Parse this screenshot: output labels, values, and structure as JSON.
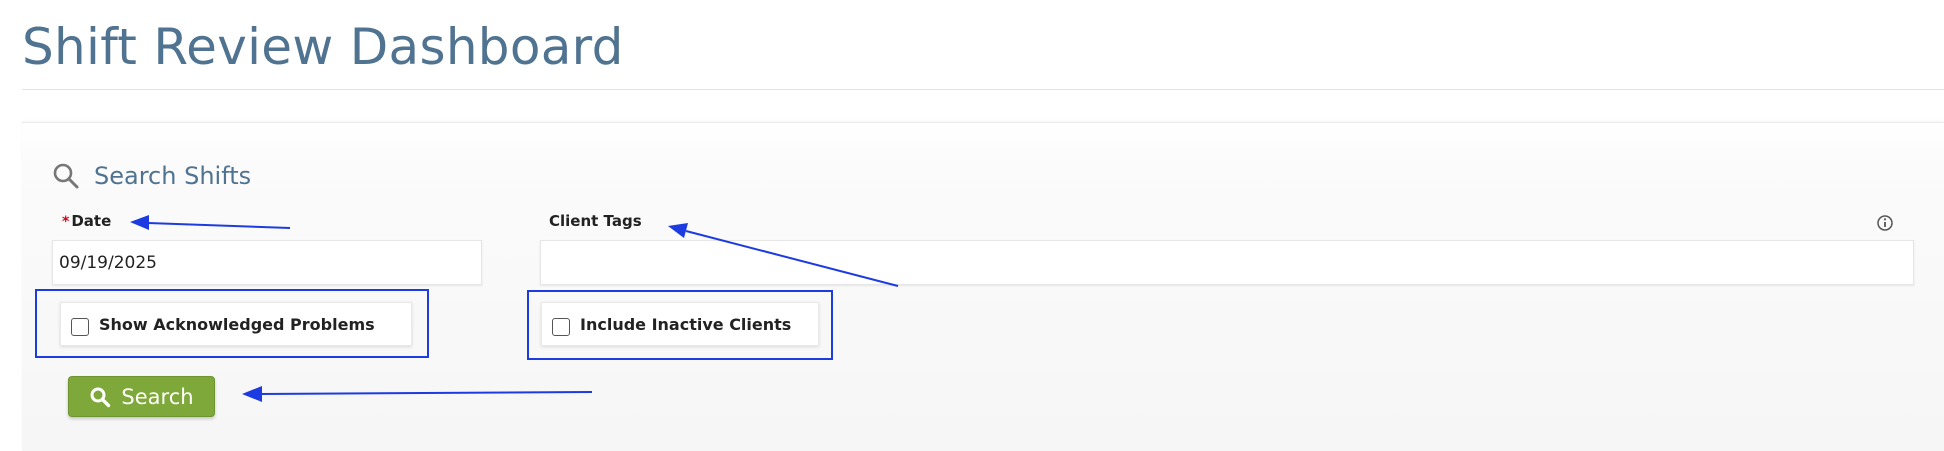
{
  "page": {
    "title": "Shift Review Dashboard"
  },
  "search_panel": {
    "header_title": "Search Shifts",
    "header_icon": "search-icon",
    "date_field": {
      "label": "Date",
      "required_marker": "*",
      "value": "09/19/2025"
    },
    "client_tags_field": {
      "label": "Client Tags",
      "value": "",
      "info_icon": "info-icon"
    },
    "show_acknowledged_problems": {
      "label": "Show Acknowledged Problems",
      "checked": false
    },
    "include_inactive_clients": {
      "label": "Include Inactive Clients",
      "checked": false
    },
    "search_button": {
      "label": "Search",
      "icon": "search-icon"
    }
  },
  "colors": {
    "title": "#4f7390",
    "button": "#7ea83a",
    "annotation": "#1c3be0",
    "required": "#d0021b"
  },
  "annotations": {
    "arrow_icon": "arrow-icon",
    "highlight_color": "#1c3be0"
  }
}
